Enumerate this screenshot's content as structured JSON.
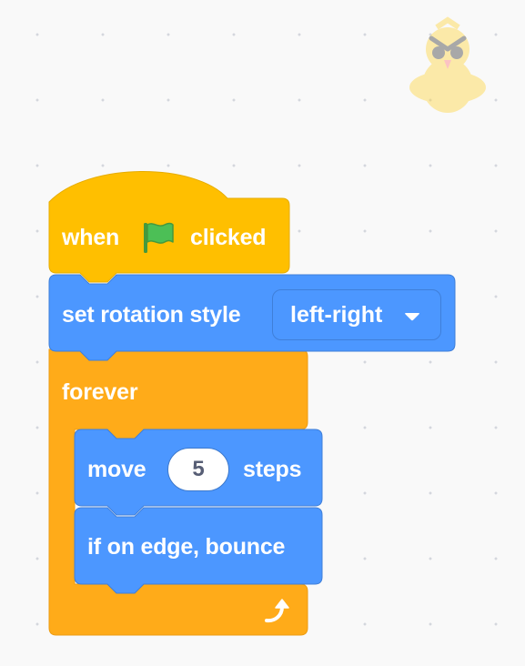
{
  "sprite": {
    "icon": "owl-sprite-icon"
  },
  "colors": {
    "events": "#ffbf00",
    "motion": "#4c97ff",
    "control": "#ffab19",
    "flag_green": "#4cbf56"
  },
  "script": {
    "hat_block": {
      "label_before": "when",
      "icon": "green-flag-icon",
      "label_after": "clicked"
    },
    "rotation_block": {
      "label": "set rotation style",
      "dropdown_value": "left-right"
    },
    "forever_block": {
      "label": "forever",
      "icon": "loop-arrow-icon"
    },
    "move_block": {
      "label_before": "move",
      "steps_value": "5",
      "label_after": "steps"
    },
    "bounce_block": {
      "label": "if on edge, bounce"
    }
  }
}
